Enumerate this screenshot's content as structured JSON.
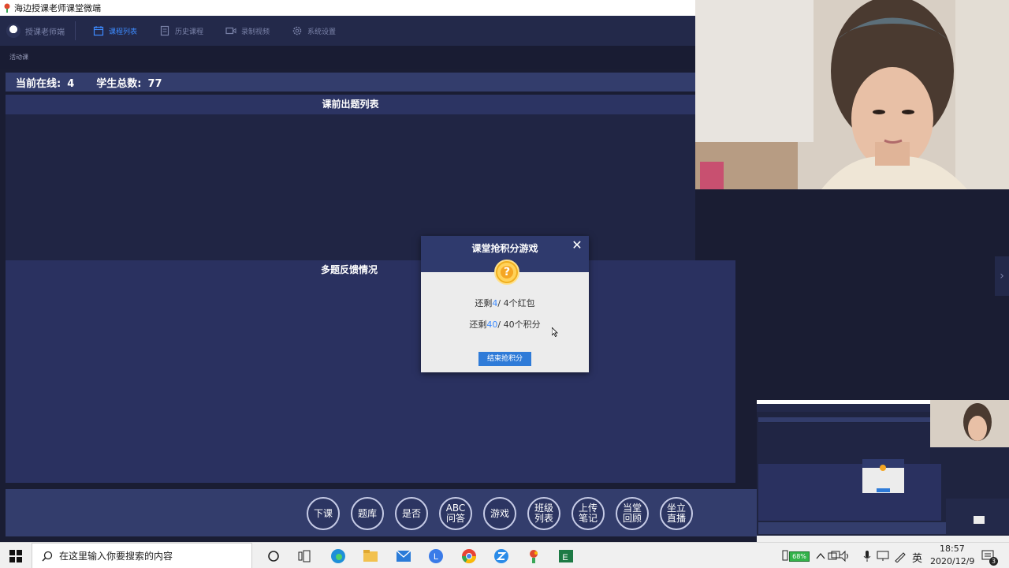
{
  "window": {
    "title": "海边授课老师课堂微端"
  },
  "nav": {
    "brand": "授课老师端",
    "items": [
      {
        "label": "课程列表",
        "icon": "calendar-icon",
        "active": true
      },
      {
        "label": "历史课程",
        "icon": "document-icon",
        "active": false
      },
      {
        "label": "录制视频",
        "icon": "video-icon",
        "active": false
      },
      {
        "label": "系统设置",
        "icon": "gear-icon",
        "active": false
      }
    ]
  },
  "subbar": {
    "label": "活动课"
  },
  "status": {
    "online_label": "当前在线:",
    "online_value": "4",
    "total_label": "学生总数:",
    "total_value": "77"
  },
  "panels": {
    "questions_title": "课前出题列表",
    "feedback_title": "多题反馈情况"
  },
  "toolbar": {
    "buttons": [
      "下课",
      "题库",
      "是否",
      "ABC\n问答",
      "游戏",
      "班级\n列表",
      "上传\n笔记",
      "当堂\n回顾",
      "坐立\n直播"
    ]
  },
  "modal": {
    "title": "课堂抢积分游戏",
    "coin_symbol": "?",
    "redpack_prefix": "还剩",
    "redpack_remaining": "4",
    "redpack_suffix": "/ 4个红包",
    "points_prefix": "还剩",
    "points_remaining": "40",
    "points_suffix": "/ 40个积分",
    "end_button": "结束抢积分"
  },
  "taskbar": {
    "search_placeholder": "在这里输入你要搜索的内容",
    "battery": "68%",
    "ime": "英",
    "time": "18:57",
    "date": "2020/12/9",
    "notification_count": "3"
  },
  "colors": {
    "accent": "#3d8bff",
    "panel": "#2a3160",
    "header": "#333d6c",
    "modal_button": "#2f7bd8"
  }
}
